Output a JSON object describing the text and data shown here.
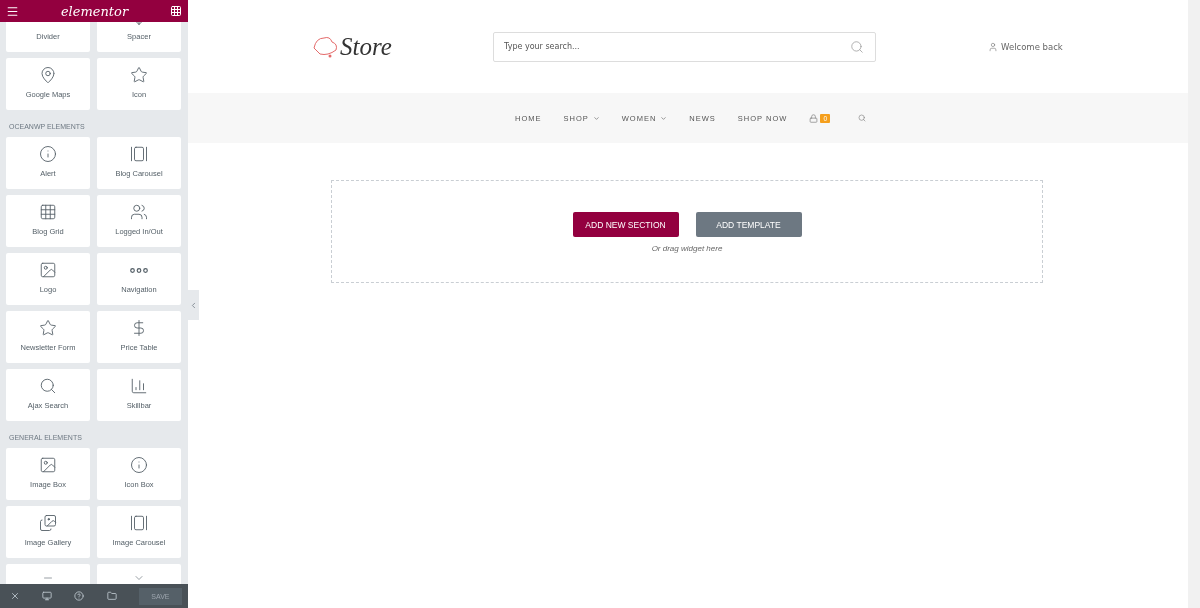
{
  "editor": {
    "brand": "elementor"
  },
  "widget_groups": [
    {
      "items": [
        {
          "kind": "widget",
          "label": "Divider"
        },
        {
          "kind": "widget",
          "label": "Spacer"
        },
        {
          "kind": "widget",
          "label": "Google Maps"
        },
        {
          "kind": "widget",
          "label": "Icon"
        }
      ]
    },
    {
      "heading": "OCEANWP ELEMENTS",
      "items": [
        {
          "kind": "widget",
          "label": "Alert"
        },
        {
          "kind": "widget",
          "label": "Blog Carousel"
        },
        {
          "kind": "widget",
          "label": "Blog Grid"
        },
        {
          "kind": "widget",
          "label": "Logged In/Out"
        },
        {
          "kind": "widget",
          "label": "Logo"
        },
        {
          "kind": "widget",
          "label": "Navigation"
        },
        {
          "kind": "widget",
          "label": "Newsletter Form"
        },
        {
          "kind": "widget",
          "label": "Price Table"
        },
        {
          "kind": "widget",
          "label": "Ajax Search"
        },
        {
          "kind": "widget",
          "label": "Skillbar"
        }
      ]
    },
    {
      "heading": "GENERAL ELEMENTS",
      "items": [
        {
          "kind": "widget",
          "label": "Image Box"
        },
        {
          "kind": "widget",
          "label": "Icon Box"
        },
        {
          "kind": "widget",
          "label": "Image Gallery"
        },
        {
          "kind": "widget",
          "label": "Image Carousel"
        },
        {
          "kind": "cut"
        },
        {
          "kind": "cut"
        }
      ]
    }
  ],
  "footer": {
    "save": "SAVE",
    "save_disabled": true
  },
  "site": {
    "logo": "Store",
    "search_placeholder": "Type your search...",
    "account": "Welcome back",
    "menu": [
      {
        "label": "HOME",
        "dropdown": false
      },
      {
        "label": "SHOP",
        "dropdown": true
      },
      {
        "label": "WOMEN",
        "dropdown": true
      },
      {
        "label": "NEWS",
        "dropdown": false
      },
      {
        "label": "SHOP NOW",
        "dropdown": false
      }
    ],
    "cart_count": "0"
  },
  "drop_area": {
    "add_section": "ADD NEW SECTION",
    "add_template": "ADD TEMPLATE",
    "hint": "Or drag widget here"
  }
}
